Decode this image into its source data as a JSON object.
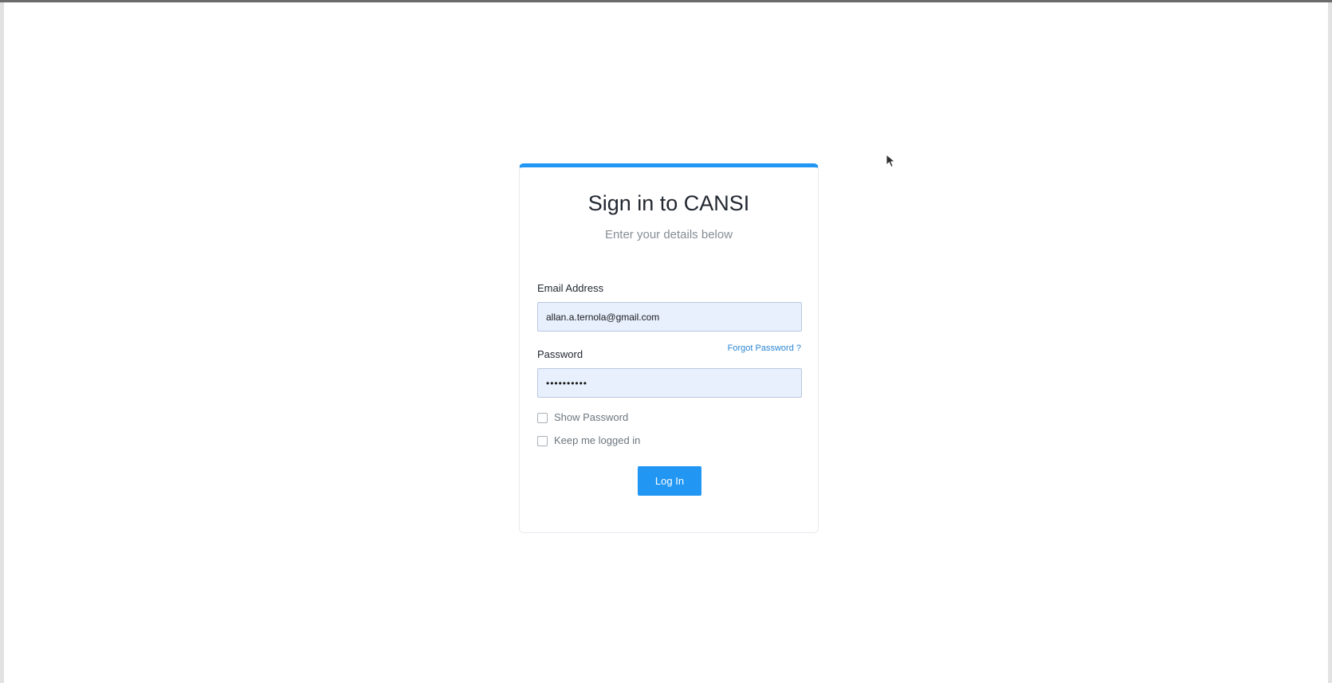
{
  "login": {
    "title": "Sign in to CANSI",
    "subtitle": "Enter your details below",
    "email_label": "Email Address",
    "email_value": "allan.a.ternola@gmail.com",
    "password_label": "Password",
    "password_value": "••••••••••",
    "forgot_link": "Forgot Password ?",
    "show_password_label": "Show Password",
    "keep_logged_in_label": "Keep me logged in",
    "login_button": "Log In",
    "show_password_checked": false,
    "keep_logged_in_checked": false
  },
  "icons": {
    "cursor": "mouse-pointer-icon"
  },
  "colors": {
    "accent": "#2196f3",
    "input_background": "#e8f0fe",
    "link": "#2a86d4"
  }
}
